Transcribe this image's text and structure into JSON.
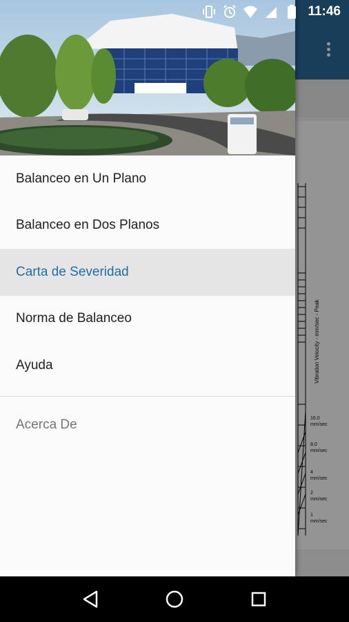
{
  "status_bar": {
    "time": "11:46",
    "icons": [
      "vibrate-icon",
      "alarm-icon",
      "wifi-icon",
      "signal-icon",
      "battery-icon"
    ]
  },
  "drawer": {
    "header_image": "building-photo",
    "menu_items": [
      {
        "label": "Balanceo en Un Plano",
        "active": false
      },
      {
        "label": "Balanceo en Dos Planos",
        "active": false
      },
      {
        "label": "Carta de Severidad",
        "active": true
      },
      {
        "label": "Norma de Balanceo",
        "active": false
      },
      {
        "label": "Ayuda",
        "active": false
      }
    ],
    "secondary_item": {
      "label": "Acerca De"
    }
  },
  "background_app": {
    "overflow_icon": "more-vert-icon",
    "chart": {
      "axis_label": "Vibration Velocity - mm/sec - Peak",
      "scale_labels": [
        "16.0",
        "mm/sec",
        "8.0",
        "mm/sec",
        "4",
        "mm/sec",
        "2",
        "mm/sec",
        "1",
        "mm/sec"
      ]
    }
  },
  "nav_bar": {
    "icons": [
      "back-icon",
      "home-icon",
      "recents-icon"
    ]
  },
  "colors": {
    "accent": "#1f6ea8",
    "appbar": "#2c6b9c",
    "drawer_bg": "#fafafa",
    "active_bg": "#e5e5e5"
  }
}
